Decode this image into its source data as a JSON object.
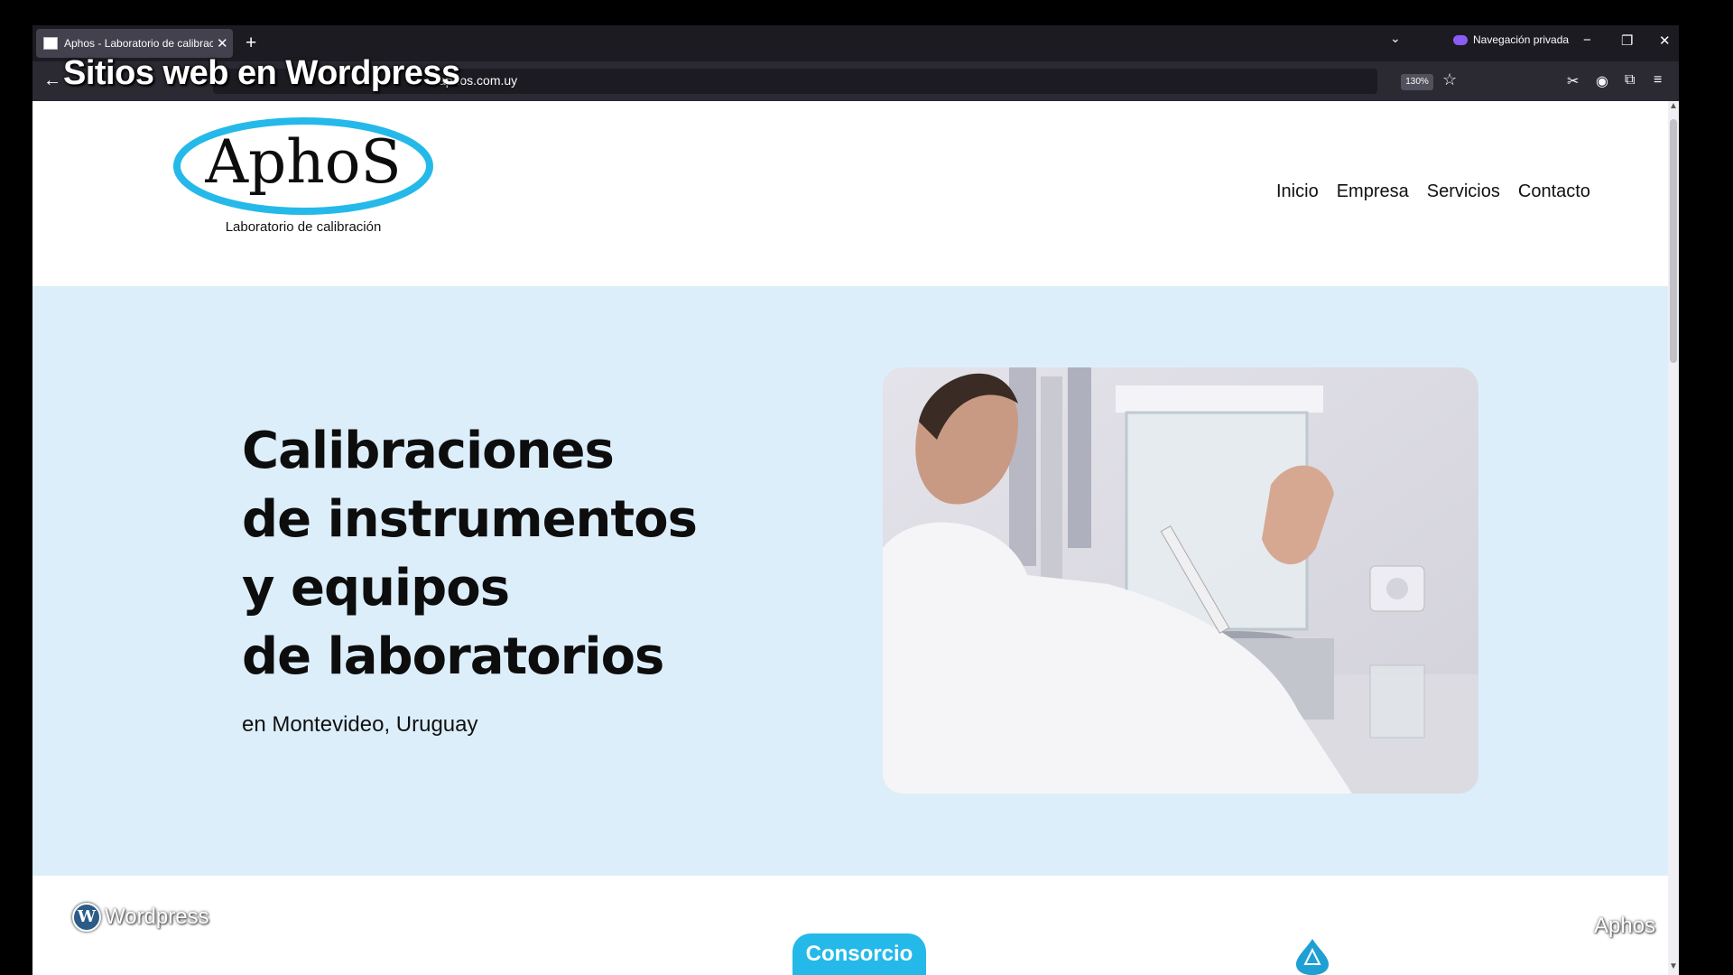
{
  "browser": {
    "tab_title": "Aphos - Laboratorio de calibración",
    "new_tab_symbol": "+",
    "close_symbol": "✕",
    "private_label": "Navegación privada",
    "url": "aphos.com.uy",
    "zoom": "130%",
    "back_symbol": "←"
  },
  "overlay": {
    "title": "Sitios web en Wordpress"
  },
  "site": {
    "logo_text": "AphoS",
    "logo_tagline": "Laboratorio de calibración",
    "nav": [
      "Inicio",
      "Empresa",
      "Servicios",
      "Contacto"
    ],
    "hero": {
      "title_lines": [
        "Calibraciones",
        "de instrumentos",
        "y equipos",
        "de laboratorios"
      ],
      "subtitle": "en Montevideo, Uruguay"
    },
    "cta_label": "Consorcio"
  },
  "watermarks": {
    "left": "Wordpress",
    "right": "Aphos"
  },
  "colors": {
    "hero_bg": "#ddeefb",
    "brand_cyan": "#25b9e9",
    "browser_dark": "#1c1b22"
  }
}
